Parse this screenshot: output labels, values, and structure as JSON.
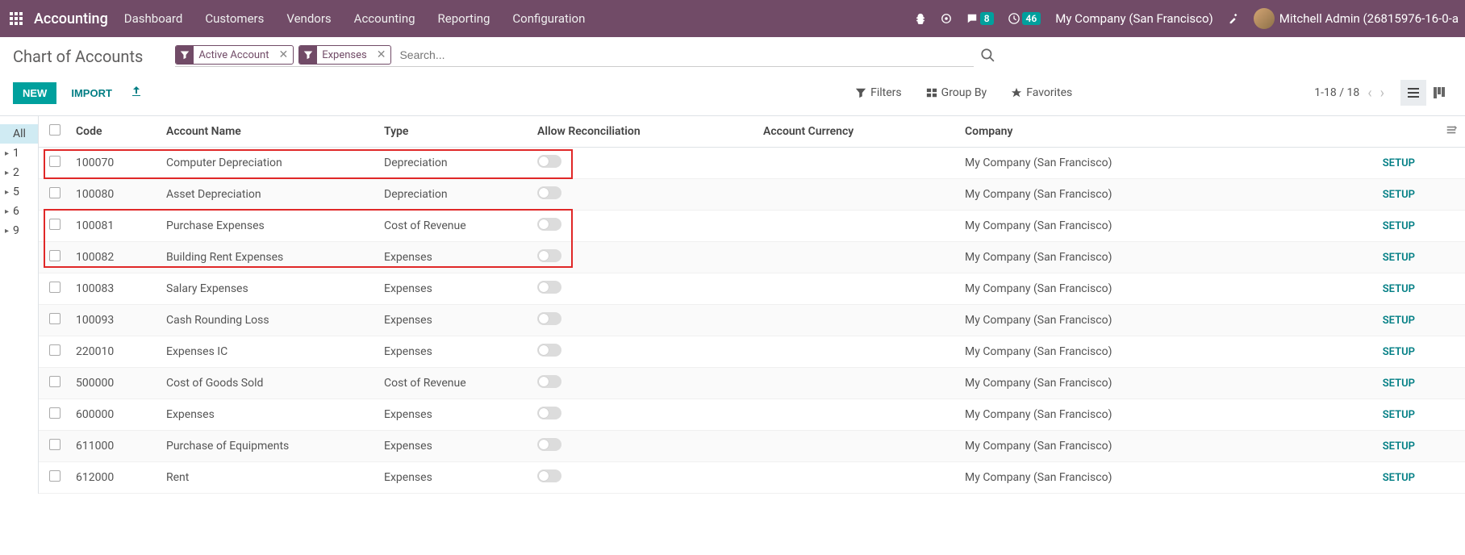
{
  "nav": {
    "brand": "Accounting",
    "menu": [
      "Dashboard",
      "Customers",
      "Vendors",
      "Accounting",
      "Reporting",
      "Configuration"
    ],
    "msg_count": "8",
    "activity_count": "46",
    "company": "My Company (San Francisco)",
    "user": "Mitchell Admin (26815976-16-0-a"
  },
  "cp": {
    "title": "Chart of Accounts",
    "facet1": "Active Account",
    "facet2": "Expenses",
    "search_placeholder": "Search...",
    "btn_new": "NEW",
    "btn_import": "IMPORT",
    "filters": "Filters",
    "groupby": "Group By",
    "favorites": "Favorites",
    "pager": "1-18 / 18"
  },
  "sidebar": {
    "items": [
      {
        "label": "All",
        "active": true,
        "caret": false
      },
      {
        "label": "1",
        "active": false,
        "caret": true
      },
      {
        "label": "2",
        "active": false,
        "caret": true
      },
      {
        "label": "5",
        "active": false,
        "caret": true
      },
      {
        "label": "6",
        "active": false,
        "caret": true
      },
      {
        "label": "9",
        "active": false,
        "caret": true
      }
    ]
  },
  "table": {
    "headers": {
      "code": "Code",
      "name": "Account Name",
      "type": "Type",
      "recon": "Allow Reconciliation",
      "curr": "Account Currency",
      "company": "Company"
    },
    "setup_label": "SETUP",
    "rows": [
      {
        "code": "100070",
        "name": "Computer Depreciation",
        "type": "Depreciation",
        "company": "My Company (San Francisco)"
      },
      {
        "code": "100080",
        "name": "Asset Depreciation",
        "type": "Depreciation",
        "company": "My Company (San Francisco)"
      },
      {
        "code": "100081",
        "name": "Purchase Expenses",
        "type": "Cost of Revenue",
        "company": "My Company (San Francisco)"
      },
      {
        "code": "100082",
        "name": "Building Rent Expenses",
        "type": "Expenses",
        "company": "My Company (San Francisco)"
      },
      {
        "code": "100083",
        "name": "Salary Expenses",
        "type": "Expenses",
        "company": "My Company (San Francisco)"
      },
      {
        "code": "100093",
        "name": "Cash Rounding Loss",
        "type": "Expenses",
        "company": "My Company (San Francisco)"
      },
      {
        "code": "220010",
        "name": "Expenses IC",
        "type": "Expenses",
        "company": "My Company (San Francisco)"
      },
      {
        "code": "500000",
        "name": "Cost of Goods Sold",
        "type": "Cost of Revenue",
        "company": "My Company (San Francisco)"
      },
      {
        "code": "600000",
        "name": "Expenses",
        "type": "Expenses",
        "company": "My Company (San Francisco)"
      },
      {
        "code": "611000",
        "name": "Purchase of Equipments",
        "type": "Expenses",
        "company": "My Company (San Francisco)"
      },
      {
        "code": "612000",
        "name": "Rent",
        "type": "Expenses",
        "company": "My Company (San Francisco)"
      }
    ]
  }
}
